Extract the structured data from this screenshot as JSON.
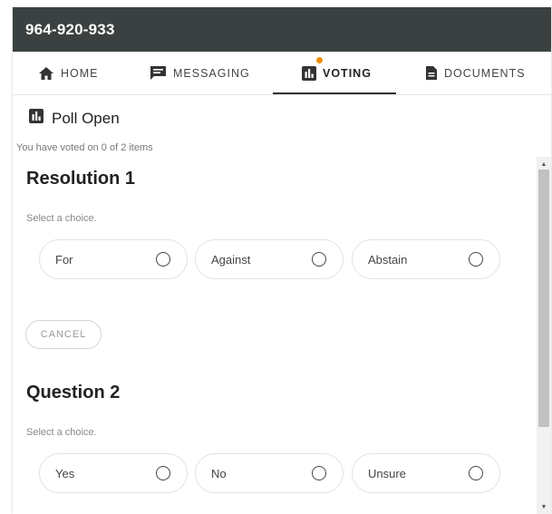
{
  "header": {
    "title": "964-920-933"
  },
  "tabs": [
    {
      "label": "HOME",
      "icon": "home-icon"
    },
    {
      "label": "MESSAGING",
      "icon": "chat-icon"
    },
    {
      "label": "VOTING",
      "icon": "poll-icon",
      "active": true
    },
    {
      "label": "DOCUMENTS",
      "icon": "document-icon"
    }
  ],
  "poll": {
    "title": "Poll Open",
    "status": "You have voted on 0 of 2 items",
    "items": [
      {
        "title": "Resolution 1",
        "hint": "Select a choice.",
        "choices": [
          "For",
          "Against",
          "Abstain"
        ],
        "cancel_label": "CANCEL"
      },
      {
        "title": "Question 2",
        "hint": "Select a choice.",
        "choices": [
          "Yes",
          "No",
          "Unsure"
        ]
      }
    ]
  },
  "colors": {
    "header_bg": "#3b4141",
    "notification_dot": "#f28c00"
  }
}
